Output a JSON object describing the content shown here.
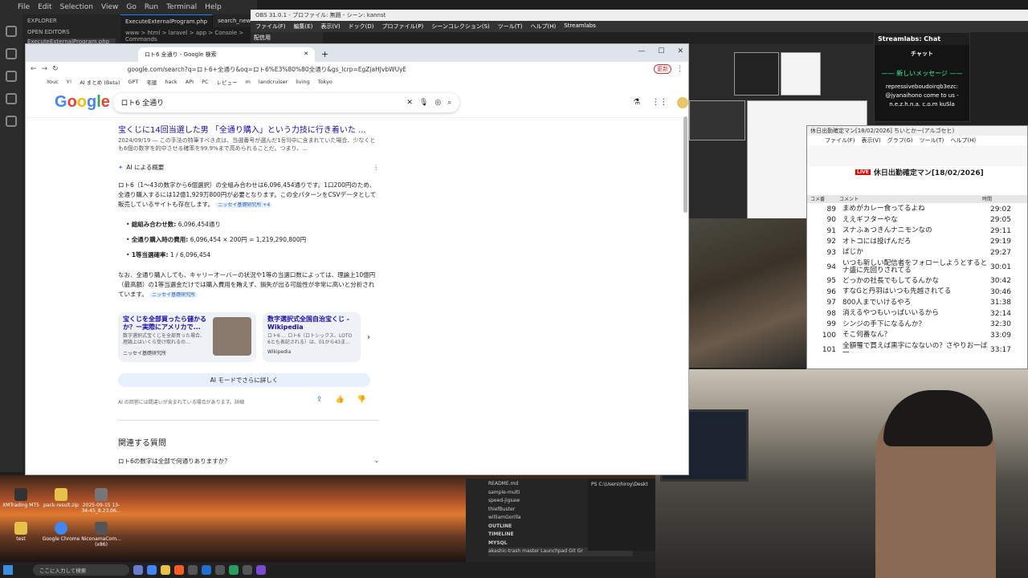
{
  "vscode": {
    "menu": [
      "File",
      "Edit",
      "Selection",
      "View",
      "Go",
      "Run",
      "Terminal",
      "Help"
    ],
    "explorer": "EXPLORER",
    "open_editors": "OPEN EDITORS",
    "open_file": "ExecuteExternalProgram.php",
    "tabs": [
      "ExecuteExternalProgram.php",
      "search_new"
    ],
    "breadcrumb": "www > html > laravel > app > Console > Commands",
    "outline": [
      "README.md",
      "sample-multi",
      "speed-jigsaw",
      "thiefBuster",
      "williamGorilla"
    ],
    "sections": [
      "OUTLINE",
      "TIMELINE",
      "MYSQL"
    ],
    "status": "akashic-trash  master  Launchpad  Git Gr",
    "terminal": "PS C:\\Users\\hiroy\\Deskt"
  },
  "obs": {
    "title": "OBS 31.0.1 - プロファイル: 無題 - シーン: kannst",
    "menu": [
      "ファイル(F)",
      "編集(E)",
      "表示(V)",
      "ドック(D)",
      "プロファイル(P)",
      "シーンコレクション(S)",
      "ツール(T)",
      "ヘルプ(H)",
      "Streamlabs"
    ],
    "dock": "配信用"
  },
  "streamlabs": {
    "header": "Streamlabs: Chat",
    "title": "チャット",
    "new_message": "—— 新しいメッセージ ——",
    "message": "repressiveboudoirqb3ezc: @jyanaihono come to us - n.e.z.h.n.a. c.o.m kuSla"
  },
  "nico": {
    "title": "休日出勤確定マン[18/02/2026] ちいとかー(アルゴセヒ)",
    "menu": [
      "ファイル(F)",
      "表示(V)",
      "グラフ(G)",
      "ツール(T)",
      "ヘルプ(H)"
    ],
    "live_badge": "LIVE",
    "live_title": "休日出勤確定マン[18/02/2026]",
    "col_no": "コメ番",
    "col_comment": "コメント",
    "col_time": "時間",
    "comments": [
      {
        "no": "89",
        "text": "まめがカレー食ってるよね",
        "time": "29:02"
      },
      {
        "no": "90",
        "text": "ええギフターやな",
        "time": "29:05"
      },
      {
        "no": "91",
        "text": "スナふぁつきんナニモンなの",
        "time": "29:11"
      },
      {
        "no": "92",
        "text": "オトコには投げんだろ",
        "time": "29:19"
      },
      {
        "no": "93",
        "text": "ぱじか",
        "time": "29:27"
      },
      {
        "no": "94",
        "text": "いつも新しい配信者をフォローしようとするとナ盛に先回りされてる",
        "time": "30:01"
      },
      {
        "no": "95",
        "text": "どっかの社長でもしてるんかな",
        "time": "30:42"
      },
      {
        "no": "96",
        "text": "すなGと丹羽はいつも先越されてる",
        "time": "30:46"
      },
      {
        "no": "97",
        "text": "800人までいけるやろ",
        "time": "31:38"
      },
      {
        "no": "98",
        "text": "消えるやつもいっぱいいるから",
        "time": "32:14"
      },
      {
        "no": "99",
        "text": "シンジの手下になるんか？",
        "time": "32:30"
      },
      {
        "no": "100",
        "text": "そこ何番なん？",
        "time": "33:09"
      },
      {
        "no": "101",
        "text": "全額罹で買えば黒字になないの？さやりお一ば一",
        "time": "33:17"
      }
    ]
  },
  "chrome": {
    "tab": "ロト6 全通り - Google 検索",
    "url": "google.com/search?q=ロト6+全通り&oq=ロト6%E3%80%80全通り&gs_lcrp=EgZjaHJvbWUyBggAEEUYOTI...",
    "bookmarks": [
      "Youc",
      "Y!",
      "AI まとめ (Beta)",
      "GPT",
      "宅建",
      "hack",
      "API",
      "PC",
      "レビュー",
      "m",
      "landcruiser",
      "living",
      "Tokyo"
    ],
    "side_label": "更新"
  },
  "google": {
    "logo": "Google",
    "query": "ロト6 全通り",
    "result": {
      "title": "宝くじに14回当選した男 「全通り購入」という力技に行き着いた ...",
      "snippet": "2024/09/19 — この手法の特筆すべき点は、当選番号が選んだ1등의中に含まれていた場合、少なくとも6個の数字を的中させる確率を99.9%まで高められることだ。つまり、..."
    },
    "ai_label": "AI による概要",
    "ai_p1": "ロト6（1〜43の数字から6個選択）の全組み合わせは6,096,454通りです。1口200円のため、全通り購入するには12億1,929万800円が必要となります。この全パターンをCSVデータとして販売しているサイトも存在します。",
    "cite1": "ニッセイ基礎研究所 +4",
    "bullets": [
      {
        "k": "総組み合わせ数:",
        "v": "6,096,454通り"
      },
      {
        "k": "全通り購入時の費用:",
        "v": "6,096,454 × 200円 = 1,219,290,800円"
      },
      {
        "k": "1等当選確率:",
        "v": "1 / 6,096,454"
      }
    ],
    "ai_p2": "なお、全通り購入しても、キャリーオーバーの状況や1等の当選口数によっては、理論上10億円（最高額）の1等当選金だけでは購入費用を賄えず、損失が出る可能性が非常に高いと分析されています。",
    "cite2": "ニッセイ基礎研究所",
    "cards": [
      {
        "title": "宝くじを全部買ったら儲かるか？ー実際にアメリカで...",
        "snip": "数字選択式宝くじを全部買った場合、理論上はいくら受け取れるの...",
        "src": "ニッセイ基礎研究所"
      },
      {
        "title": "数字選択式全国自治宝くじ - Wikipedia",
        "snip": "ロト6 ... ロト6（ロトシックス、LOTO 6とも表記される）は、01から43ま...",
        "src": "Wikipedia"
      }
    ],
    "ai_mode": "AI モードでさらに詳しく",
    "disclaimer": "AI の回答には間違いが含まれている場合があります。詳細",
    "related": "関連する質問",
    "related_q": "ロト6の数字は全部で何通りありますか？"
  },
  "desktop": {
    "icons": [
      {
        "l": "XMTrading MT5",
        "c": "#333"
      },
      {
        "l": "pack-result.zip",
        "c": "#e6c24a"
      },
      {
        "l": "2025-09-15 13-34-45_8.23.06...",
        "c": "#777"
      },
      {
        "l": "test",
        "c": "#e6c24a"
      },
      {
        "l": "Google Chrome",
        "c": "#4285f4"
      },
      {
        "l": "NiconamaCom... (x86)",
        "c": "#555"
      }
    ]
  },
  "taskbar": {
    "search": "ここに入力して検索"
  }
}
